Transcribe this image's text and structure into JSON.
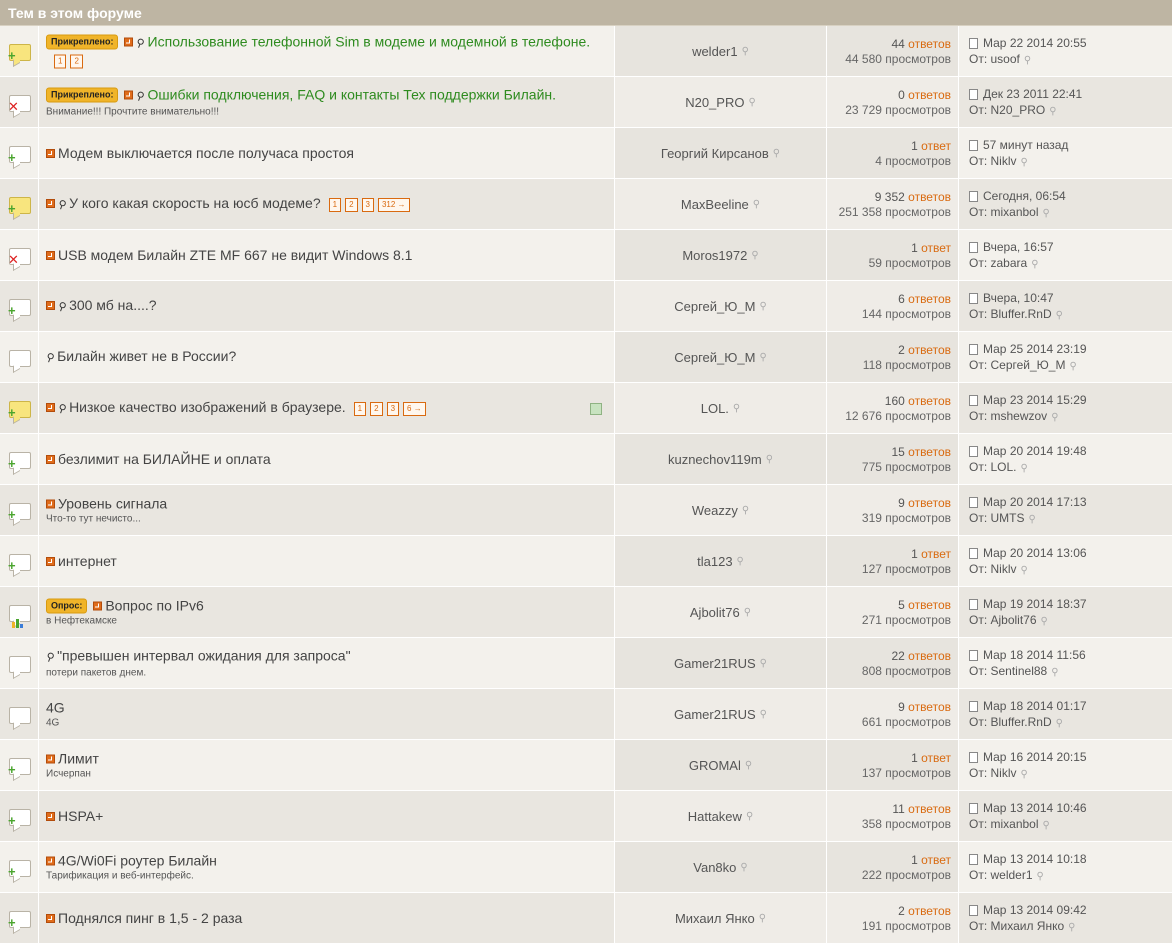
{
  "header": {
    "title": "Тем в этом форуме"
  },
  "icon_colors": {
    "hot": "#f8e57e",
    "plus": "#4aa52e",
    "closed": "#dd2222",
    "page_link": "#d96a10",
    "pinned_title": "#2e8b1f"
  },
  "topics": [
    {
      "status_icon": "folder-hot-plus-icon",
      "badge": "Прикреплено:",
      "rss": true,
      "clip": true,
      "title": "Использование телефонной Sim в модеме и модемной в телефоне.",
      "pinned": true,
      "desc": "",
      "pages": [
        "1",
        "2"
      ],
      "hot_icon": false,
      "author": "welder1",
      "replies_count": "44",
      "replies_word": "ответов",
      "views": "44 580 просмотров",
      "last_date": "Мар 22 2014 20:55",
      "last_prefix": "От:",
      "last_user": "usoof"
    },
    {
      "status_icon": "folder-closed-x-icon",
      "badge": "Прикреплено:",
      "rss": true,
      "clip": true,
      "title": "Ошибки подключения, FAQ и контакты Тех поддержки Билайн.",
      "pinned": true,
      "desc": "Внимание!!! Прочтите внимательно!!!",
      "pages": [],
      "hot_icon": false,
      "author": "N20_PRO",
      "replies_count": "0",
      "replies_word": "ответов",
      "views": "23 729 просмотров",
      "last_date": "Дек 23 2011 22:41",
      "last_prefix": "От:",
      "last_user": "N20_PRO"
    },
    {
      "status_icon": "folder-plus-icon",
      "badge": "",
      "rss": true,
      "clip": false,
      "title": "Модем выключается после получаса простоя",
      "pinned": false,
      "desc": "",
      "pages": [],
      "hot_icon": false,
      "author": "Георгий Кирсанов",
      "replies_count": "1",
      "replies_word": "ответ",
      "views": "4 просмотров",
      "last_date": "57 минут назад",
      "last_prefix": "От:",
      "last_user": "Niklv"
    },
    {
      "status_icon": "folder-hot-plus-icon",
      "badge": "",
      "rss": true,
      "clip": true,
      "title": "У кого какая скорость на юсб модеме?",
      "pinned": false,
      "desc": "",
      "pages": [
        "1",
        "2",
        "3",
        "312 →"
      ],
      "hot_icon": false,
      "author": "MaxBeeline",
      "replies_count": "9 352",
      "replies_word": "ответов",
      "views": "251 358 просмотров",
      "last_date": "Сегодня, 06:54",
      "last_prefix": "От:",
      "last_user": "mixanbol"
    },
    {
      "status_icon": "folder-closed-x-icon",
      "badge": "",
      "rss": true,
      "clip": false,
      "title": "USB модем Билайн ZTE MF 667 не видит Windows 8.1",
      "pinned": false,
      "desc": "",
      "pages": [],
      "hot_icon": false,
      "author": "Moros1972",
      "replies_count": "1",
      "replies_word": "ответ",
      "views": "59 просмотров",
      "last_date": "Вчера, 16:57",
      "last_prefix": "От:",
      "last_user": "zabara"
    },
    {
      "status_icon": "folder-plus-icon",
      "badge": "",
      "rss": true,
      "clip": true,
      "title": "300 мб на....?",
      "pinned": false,
      "desc": "",
      "pages": [],
      "hot_icon": false,
      "author": "Сергей_Ю_М",
      "replies_count": "6",
      "replies_word": "ответов",
      "views": "144 просмотров",
      "last_date": "Вчера, 10:47",
      "last_prefix": "От:",
      "last_user": "Bluffer.RnD"
    },
    {
      "status_icon": "folder-icon",
      "badge": "",
      "rss": false,
      "clip": true,
      "title": "Билайн живет не в России?",
      "pinned": false,
      "desc": "",
      "pages": [],
      "hot_icon": false,
      "author": "Сергей_Ю_М",
      "replies_count": "2",
      "replies_word": "ответов",
      "views": "118 просмотров",
      "last_date": "Мар 25 2014 23:19",
      "last_prefix": "От:",
      "last_user": "Сергей_Ю_М"
    },
    {
      "status_icon": "folder-hot-plus-icon",
      "badge": "",
      "rss": true,
      "clip": true,
      "title": "Низкое качество изображений в браузере.",
      "pinned": false,
      "desc": "",
      "pages": [
        "1",
        "2",
        "3",
        "6 →"
      ],
      "hot_icon": true,
      "author": "LOL.",
      "replies_count": "160",
      "replies_word": "ответов",
      "views": "12 676 просмотров",
      "last_date": "Мар 23 2014 15:29",
      "last_prefix": "От:",
      "last_user": "mshewzov"
    },
    {
      "status_icon": "folder-plus-icon",
      "badge": "",
      "rss": true,
      "clip": false,
      "title": "безлимит на БИЛАЙНЕ и оплата",
      "pinned": false,
      "desc": "",
      "pages": [],
      "hot_icon": false,
      "author": "kuznechov119m",
      "replies_count": "15",
      "replies_word": "ответов",
      "views": "775 просмотров",
      "last_date": "Мар 20 2014 19:48",
      "last_prefix": "От:",
      "last_user": "LOL."
    },
    {
      "status_icon": "folder-plus-icon",
      "badge": "",
      "rss": true,
      "clip": false,
      "title": "Уровень сигнала",
      "pinned": false,
      "desc": "Что-то тут нечисто...",
      "pages": [],
      "hot_icon": false,
      "author": "Weazzy",
      "replies_count": "9",
      "replies_word": "ответов",
      "views": "319 просмотров",
      "last_date": "Мар 20 2014 17:13",
      "last_prefix": "От:",
      "last_user": "UMTS"
    },
    {
      "status_icon": "folder-plus-icon",
      "badge": "",
      "rss": true,
      "clip": false,
      "title": "интернет",
      "pinned": false,
      "desc": "",
      "pages": [],
      "hot_icon": false,
      "author": "tla123",
      "replies_count": "1",
      "replies_word": "ответ",
      "views": "127 просмотров",
      "last_date": "Мар 20 2014 13:06",
      "last_prefix": "От:",
      "last_user": "Niklv"
    },
    {
      "status_icon": "folder-poll-icon",
      "badge": "Опрос:",
      "rss": true,
      "clip": false,
      "title": "Вопрос по IPv6",
      "pinned": false,
      "desc": "в Нефтекамске",
      "pages": [],
      "hot_icon": false,
      "author": "Ajbolit76",
      "replies_count": "5",
      "replies_word": "ответов",
      "views": "271 просмотров",
      "last_date": "Мар 19 2014 18:37",
      "last_prefix": "От:",
      "last_user": "Ajbolit76"
    },
    {
      "status_icon": "folder-icon",
      "badge": "",
      "rss": false,
      "clip": true,
      "title": "\"превышен интервал ожидания для запроса\"",
      "pinned": false,
      "desc": "потери пакетов днем.",
      "pages": [],
      "hot_icon": false,
      "author": "Gamer21RUS",
      "replies_count": "22",
      "replies_word": "ответов",
      "views": "808 просмотров",
      "last_date": "Мар 18 2014 11:56",
      "last_prefix": "От:",
      "last_user": "Sentinel88"
    },
    {
      "status_icon": "folder-icon",
      "badge": "",
      "rss": false,
      "clip": false,
      "title": "4G",
      "pinned": false,
      "desc": "4G",
      "pages": [],
      "hot_icon": false,
      "author": "Gamer21RUS",
      "replies_count": "9",
      "replies_word": "ответов",
      "views": "661 просмотров",
      "last_date": "Мар 18 2014 01:17",
      "last_prefix": "От:",
      "last_user": "Bluffer.RnD"
    },
    {
      "status_icon": "folder-plus-icon",
      "badge": "",
      "rss": true,
      "clip": false,
      "title": "Лимит",
      "pinned": false,
      "desc": "Исчерпан",
      "pages": [],
      "hot_icon": false,
      "author": "GROMAl",
      "replies_count": "1",
      "replies_word": "ответ",
      "views": "137 просмотров",
      "last_date": "Мар 16 2014 20:15",
      "last_prefix": "От:",
      "last_user": "Niklv"
    },
    {
      "status_icon": "folder-plus-icon",
      "badge": "",
      "rss": true,
      "clip": false,
      "title": "HSPA+",
      "pinned": false,
      "desc": "",
      "pages": [],
      "hot_icon": false,
      "author": "Hattakew",
      "replies_count": "11",
      "replies_word": "ответов",
      "views": "358 просмотров",
      "last_date": "Мар 13 2014 10:46",
      "last_prefix": "От:",
      "last_user": "mixanbol"
    },
    {
      "status_icon": "folder-plus-icon",
      "badge": "",
      "rss": true,
      "clip": false,
      "title": "4G/Wi0Fi роутер Билайн",
      "pinned": false,
      "desc": "Тарификация и веб-интерфейс.",
      "pages": [],
      "hot_icon": false,
      "author": "Van8ko",
      "replies_count": "1",
      "replies_word": "ответ",
      "views": "222 просмотров",
      "last_date": "Мар 13 2014 10:18",
      "last_prefix": "От:",
      "last_user": "welder1"
    },
    {
      "status_icon": "folder-plus-icon",
      "badge": "",
      "rss": true,
      "clip": false,
      "title": "Поднялся пинг в 1,5 - 2 раза",
      "pinned": false,
      "desc": "",
      "pages": [],
      "hot_icon": false,
      "author": "Михаил Янко",
      "replies_count": "2",
      "replies_word": "ответов",
      "views": "191 просмотров",
      "last_date": "Мар 13 2014 09:42",
      "last_prefix": "От:",
      "last_user": "Михаил Янко"
    }
  ]
}
